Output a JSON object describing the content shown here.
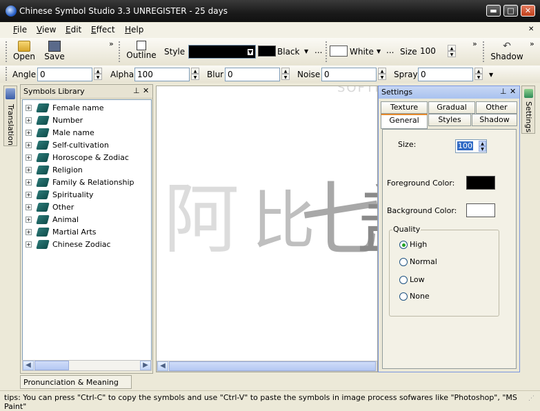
{
  "window": {
    "title": "Chinese Symbol Studio 3.3 UNREGISTER - 25 days",
    "buttons": {
      "minimize": "▬",
      "maximize": "□",
      "close": "✕"
    }
  },
  "menu": [
    {
      "first": "F",
      "rest": "ile"
    },
    {
      "first": "V",
      "rest": "iew"
    },
    {
      "first": "E",
      "rest": "dit"
    },
    {
      "first": "E",
      "rest": "ffect"
    },
    {
      "first": "H",
      "rest": "elp"
    }
  ],
  "toolbar": {
    "open_label": "Open",
    "save_label": "Save",
    "outline_label": "Outline",
    "style_label": "Style",
    "color1_name": "Black",
    "color1_hex": "#000000",
    "color2_name": "White",
    "color2_hex": "#ffffff",
    "ellipsis": "...",
    "size_label": "Size",
    "size_value": "100",
    "shadow_label": "Shadow",
    "overflow": "»"
  },
  "effectbar": {
    "angle_label": "Angle",
    "angle_value": "0",
    "alpha_label": "Alpha",
    "alpha_value": "100",
    "blur_label": "Blur",
    "blur_value": "0",
    "noise_label": "Noise",
    "noise_value": "0",
    "spray_label": "Spray",
    "spray_value": "0"
  },
  "left_dock_tab": "Translation",
  "library": {
    "title": "Symbols Library",
    "items": [
      "Female name",
      "Number",
      "Male name",
      "Self-cultivation",
      "Horoscope & Zodiac",
      "Religion",
      "Family & Relationship",
      "Spirituality",
      "Other",
      "Animal",
      "Martial Arts",
      "Chinese Zodiac"
    ]
  },
  "bottom_tab": "Pronunciation & Meaning",
  "canvas": {
    "chars": [
      "阿",
      "比",
      "七",
      "盖"
    ],
    "watermark": "SOFTPEDIA"
  },
  "settings": {
    "title": "Settings",
    "tabs_row1": [
      "Texture",
      "Gradual",
      "Other"
    ],
    "tabs_row2": [
      "General",
      "Styles",
      "Shadow"
    ],
    "active_tab": "General",
    "size_label": "Size:",
    "size_value": "100",
    "fg_label": "Foreground Color:",
    "fg_hex": "#000000",
    "bg_label": "Background Color:",
    "bg_hex": "#ffffff",
    "quality_label": "Quality",
    "quality_options": [
      "High",
      "Normal",
      "Low",
      "None"
    ],
    "quality_selected": "High"
  },
  "right_dock_tab": "Settings",
  "status": "tips: You can press \"Ctrl-C\" to copy the symbols and use \"Ctrl-V\" to paste the symbols in image process sofwares like \"Photoshop\", \"MS Paint\""
}
